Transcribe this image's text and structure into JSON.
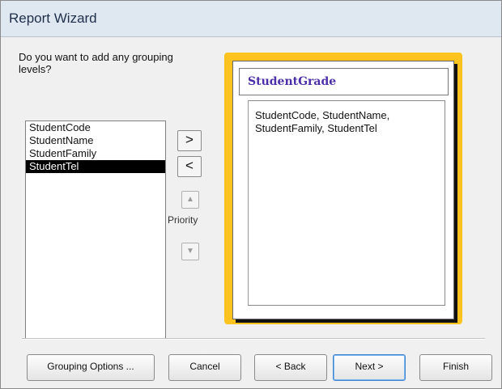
{
  "window": {
    "title": "Report Wizard"
  },
  "question": "Do you want to add any grouping levels?",
  "fields": [
    {
      "label": "StudentCode",
      "selected": false
    },
    {
      "label": "StudentName",
      "selected": false
    },
    {
      "label": "StudentFamily",
      "selected": false
    },
    {
      "label": "StudentTel",
      "selected": true
    }
  ],
  "controls": {
    "add_label": ">",
    "remove_label": "<",
    "priority_label": "Priority",
    "up_icon": "up-arrow-icon",
    "down_icon": "down-arrow-icon"
  },
  "preview": {
    "group_title": "StudentGrade",
    "detail_fields": "StudentCode, StudentName, StudentFamily, StudentTel"
  },
  "buttons": {
    "grouping_options": "Grouping Options ...",
    "cancel": "Cancel",
    "back": "< Back",
    "next": "Next >",
    "finish": "Finish"
  },
  "colors": {
    "preview_border": "#ffc31f",
    "group_title": "#4b2ea8",
    "selection": "#000000"
  }
}
